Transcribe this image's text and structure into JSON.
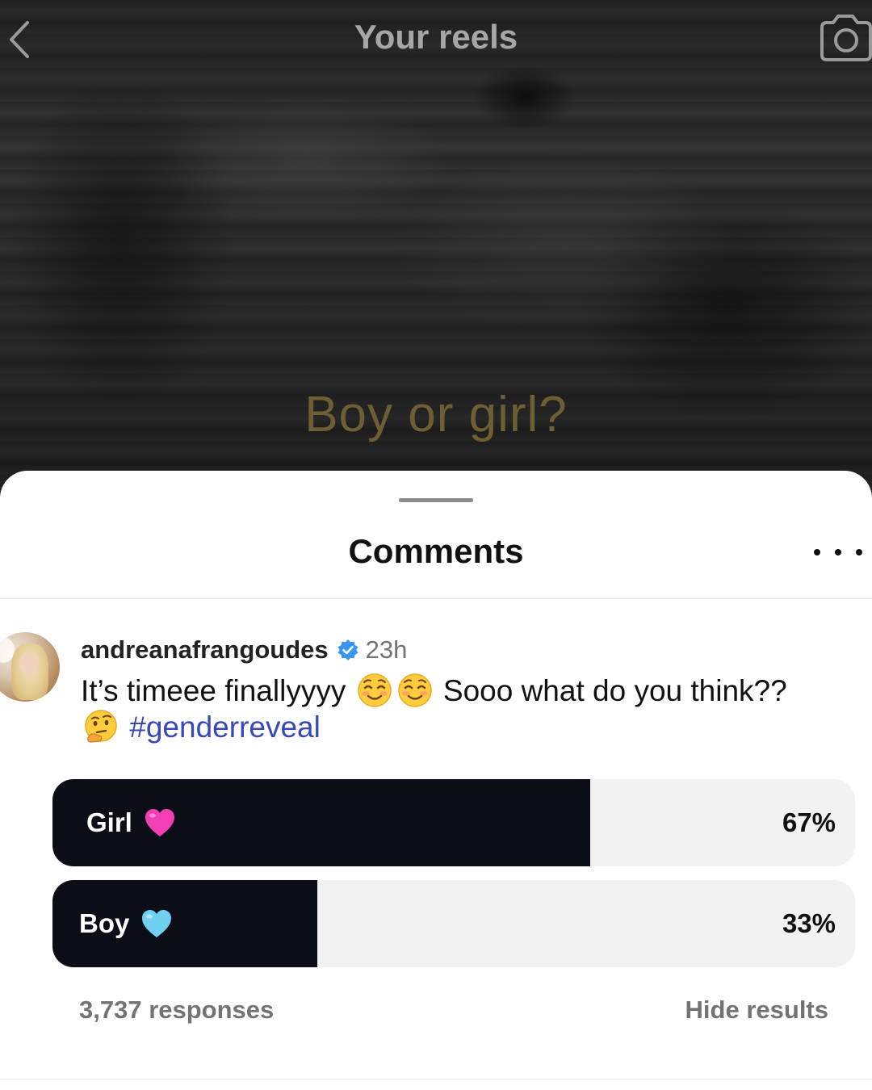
{
  "header": {
    "title": "Your reels",
    "back_icon": "chevron-left-icon",
    "camera_icon": "camera-icon"
  },
  "video": {
    "overlay_text": "Boy or girl?"
  },
  "sheet": {
    "title": "Comments",
    "more_icon": "more-horizontal-icon"
  },
  "comment": {
    "username": "andreanafrangoudes",
    "verified": true,
    "time": "23h",
    "text_part1": "It’s timeee finallyyyy",
    "emoji1": "smiling-face-icon",
    "emoji2": "smiling-face-icon",
    "text_part2": "Sooo what do you think??",
    "emoji3": "thinking-face-icon",
    "hashtag": "#genderreveal"
  },
  "poll": {
    "options": [
      {
        "label": "Girl",
        "icon": "pink-heart-icon",
        "percent_text": "67%",
        "percent": 67
      },
      {
        "label": "Boy",
        "icon": "light-blue-heart-icon",
        "percent_text": "33%",
        "percent": 33
      }
    ],
    "responses": "3,737 responses",
    "hide_results": "Hide results"
  },
  "colors": {
    "poll_fill": "#0b0e17",
    "poll_track": "#f2f2f2",
    "hashtag": "#3848b5",
    "verified_blue": "#3797f0",
    "overlay_text": "#6e5e34"
  }
}
